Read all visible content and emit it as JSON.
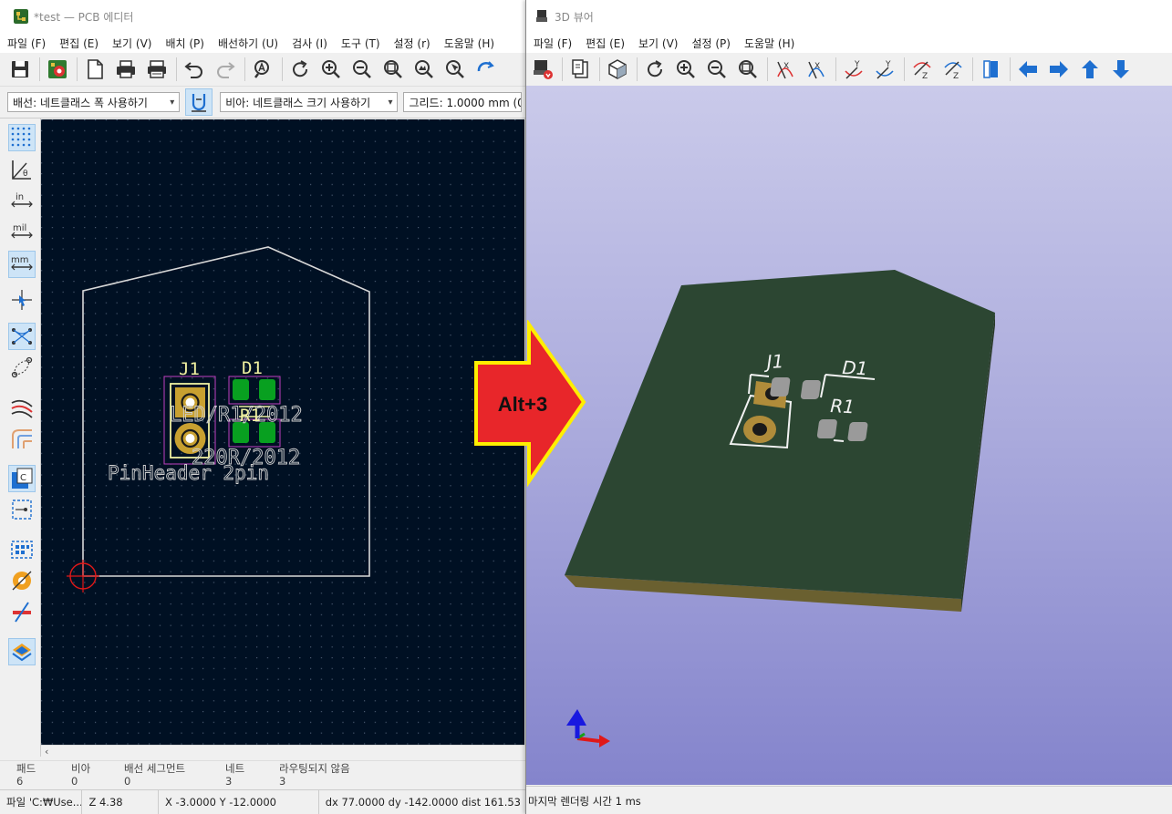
{
  "pcb_editor": {
    "title": "*test — PCB 에디터",
    "menu": [
      "파일 (F)",
      "편집 (E)",
      "보기 (V)",
      "배치 (P)",
      "배선하기 (U)",
      "검사 (I)",
      "도구 (T)",
      "설정 (r)",
      "도움말 (H)"
    ],
    "track_select": "배선: 네트클래스 폭 사용하기",
    "via_select": "비아: 네트클래스 크기 사용하기",
    "grid_select": "그리드: 1.0000 mm (0",
    "canvas": {
      "silk_j1": "J1",
      "silk_d1": "D1",
      "fab_led": "LED/R1/2012",
      "fab_r1": "R1",
      "fab_res": "220R/2012",
      "fab_header": "PinHeader 2pin"
    },
    "message_panel": {
      "pads_label": "패드",
      "pads_value": "6",
      "vias_label": "비아",
      "vias_value": "0",
      "segments_label": "배선 세그먼트",
      "segments_value": "0",
      "nets_label": "네트",
      "nets_value": "3",
      "unrouted_label": "라우팅되지 않음",
      "unrouted_value": "3"
    },
    "status": {
      "file": "파일 'C:₩Use...",
      "zoom": "Z 4.38",
      "xy": "X -3.0000  Y -12.0000",
      "delta": "dx 77.0000  dy -142.0000  dist 161.53"
    }
  },
  "viewer_3d": {
    "title": "3D 뷰어",
    "menu": [
      "파일 (F)",
      "편집 (E)",
      "보기 (V)",
      "설정 (P)",
      "도움말 (H)"
    ],
    "silk_j1": "J1",
    "silk_d1": "D1",
    "silk_r1": "R1",
    "status": "마지막 렌더링 시간 1 ms"
  },
  "callout": {
    "label": "Alt+3",
    "fill": "#e8262a",
    "outline": "#ffee00"
  },
  "colors": {
    "pcb_background": "#001023",
    "board_outline": "#d8d8d8",
    "silkscreen": "#f0f0a0",
    "pad_copper": "#c8a030",
    "pad_smd": "#08a020",
    "board_3d": "#2c4632",
    "viewer_bg_top": "#cacaea",
    "viewer_bg_bottom": "#8484cc"
  }
}
